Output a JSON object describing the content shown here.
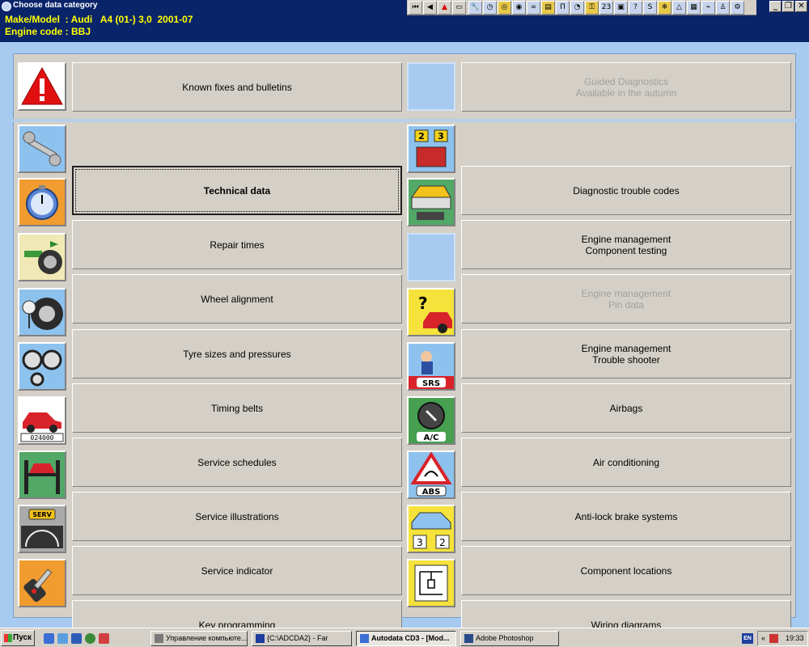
{
  "window": {
    "title": "Choose data category"
  },
  "vehicle": {
    "make_model_label": "Make/Model  : Audi   A4 (01-) 3,0  2001-07",
    "engine_code_label": "Engine code : BBJ"
  },
  "left": [
    {
      "label": "Known fixes and bulletins",
      "icon": "warning-icon"
    },
    {
      "label": "Technical data",
      "icon": "wrench-icon"
    },
    {
      "label": "Repair times",
      "icon": "stopwatch-icon"
    },
    {
      "label": "Wheel alignment",
      "icon": "wheel-alignment-icon"
    },
    {
      "label": "Tyre sizes and pressures",
      "icon": "tyre-pressure-icon"
    },
    {
      "label": "Timing belts",
      "icon": "timing-belt-icon"
    },
    {
      "label": "Service schedules",
      "icon": "odometer-car-icon",
      "odometer": "024000"
    },
    {
      "label": "Service illustrations",
      "icon": "car-lift-icon"
    },
    {
      "label": "Service indicator",
      "icon": "service-indicator-icon",
      "badge": "SERV"
    },
    {
      "label": "Key programming",
      "icon": "key-icon"
    }
  ],
  "right": [
    {
      "label": "Guided Diagnostics\nAvailable in the autumn",
      "icon": "",
      "disabled": true
    },
    {
      "label": "Diagnostic trouble codes",
      "icon": "dtc-icon",
      "digits": [
        "2",
        "3"
      ]
    },
    {
      "label": "Engine management\nComponent testing",
      "icon": "engine-test-icon"
    },
    {
      "label": "Engine management\nPin data",
      "icon": "",
      "disabled": true
    },
    {
      "label": "Engine management\nTrouble shooter",
      "icon": "trouble-shooter-icon"
    },
    {
      "label": "Airbags",
      "icon": "airbag-icon",
      "badge": "SRS"
    },
    {
      "label": "Air conditioning",
      "icon": "ac-icon",
      "badge": "A/C"
    },
    {
      "label": "Anti-lock brake systems",
      "icon": "abs-icon",
      "badge": "ABS"
    },
    {
      "label": "Component locations",
      "icon": "component-locations-icon",
      "digits": [
        "3",
        "2"
      ]
    },
    {
      "label": "Wiring diagrams",
      "icon": "wiring-diagram-icon"
    }
  ],
  "taskbar": {
    "start_label": "Пуск",
    "tasks": [
      {
        "label": "Управление компьюте..."
      },
      {
        "label": "{C:\\ADCDA2} - Far"
      },
      {
        "label": "Autodata CD3 - [Mod..."
      },
      {
        "label": "Adobe Photoshop"
      }
    ],
    "lang": "EN",
    "clock": "19:33"
  },
  "colors": {
    "title_bg": "#0a246a",
    "header_text": "#ffff00",
    "panel_bg": "#a6caf0",
    "button_bg": "#d4d0c8"
  }
}
